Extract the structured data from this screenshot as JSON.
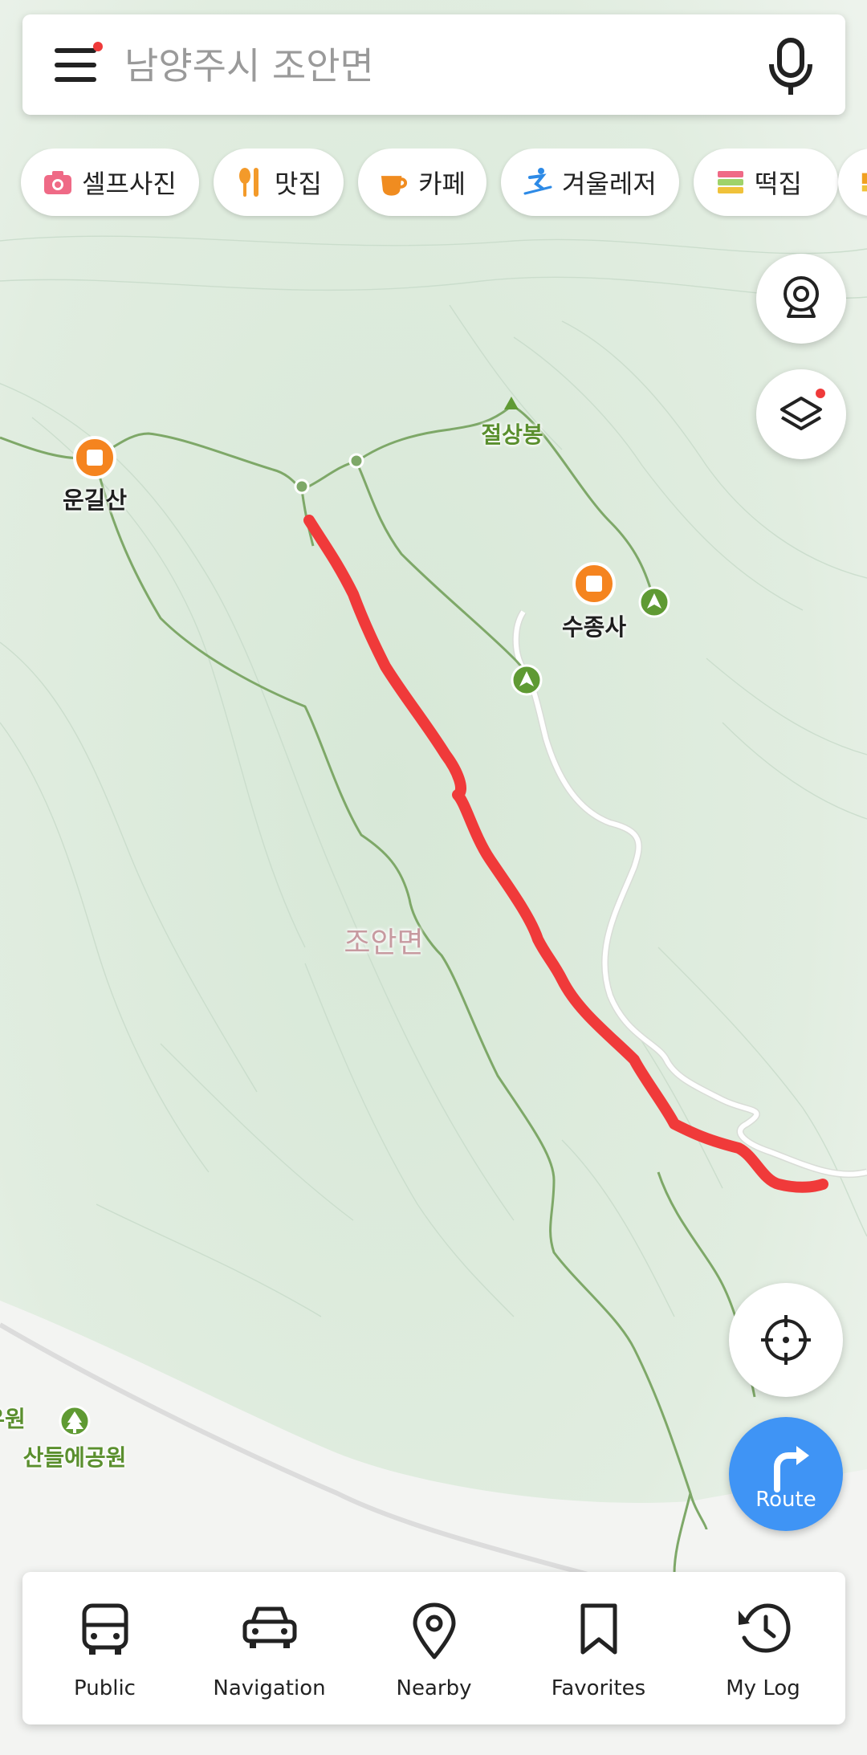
{
  "search": {
    "placeholder": "남양주시 조안면"
  },
  "categories": [
    {
      "label": "셀프사진",
      "icon": "camera-icon",
      "color": "#ef6a86"
    },
    {
      "label": "맛집",
      "icon": "utensils-icon",
      "color": "#f39a2a"
    },
    {
      "label": "카페",
      "icon": "coffee-cup-icon",
      "color": "#f08c20"
    },
    {
      "label": "겨울레저",
      "icon": "skier-icon",
      "color": "#2d8ae6"
    },
    {
      "label": "떡집",
      "icon": "rice-cake-icon",
      "color": "#f0c23a"
    }
  ],
  "map": {
    "labels": {
      "peak": "절상봉",
      "poi_left": "운길산",
      "poi_right": "수종사",
      "region": "조안면",
      "park": "산들에공원",
      "edge_partial": "우원"
    },
    "colors": {
      "route": "#f03a3a",
      "trail": "#7ea868",
      "poi": "#f5841f",
      "park_marker": "#5f9a33",
      "road": "#ffffff"
    }
  },
  "route_button": {
    "label": "Route"
  },
  "bottom_nav": [
    {
      "label": "Public",
      "icon": "bus-icon"
    },
    {
      "label": "Navigation",
      "icon": "car-icon"
    },
    {
      "label": "Nearby",
      "icon": "location-pin-icon"
    },
    {
      "label": "Favorites",
      "icon": "bookmark-icon"
    },
    {
      "label": "My Log",
      "icon": "history-icon"
    }
  ]
}
